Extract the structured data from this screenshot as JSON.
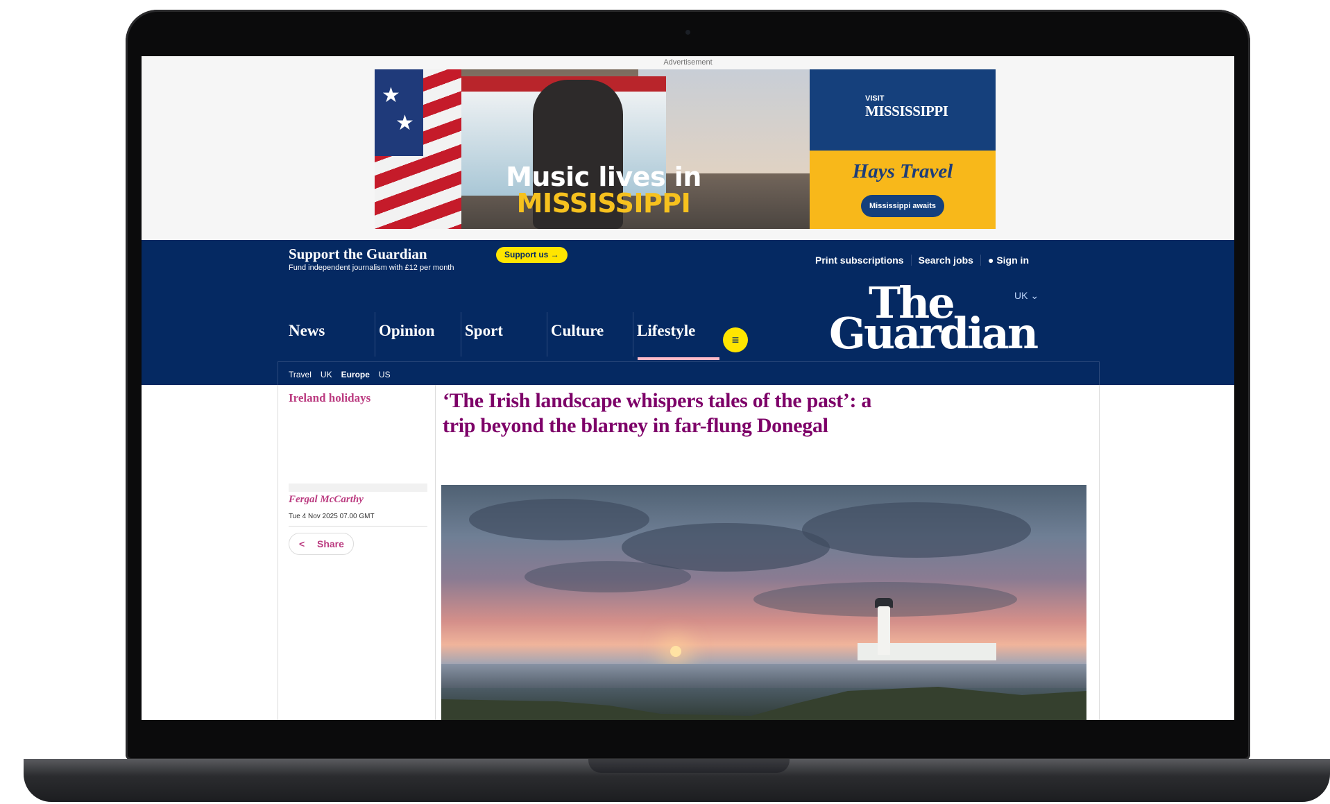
{
  "advertisement": {
    "label": "Advertisement",
    "headline_line1": "Music lives in",
    "headline_line2": "MISSISSIPPI",
    "visit_small": "VISIT",
    "visit_big": "MISSISSIPPI",
    "partner": "Hays Travel",
    "cta": "Mississippi awaits"
  },
  "support_bar": {
    "title": "Support the Guardian",
    "subtitle": "Fund independent journalism with £12 per month",
    "button": "Support us →",
    "links": [
      "Print subscriptions",
      "Search jobs",
      "Sign in"
    ]
  },
  "nav": {
    "edition": "UK ⌄",
    "logo_line1": "The",
    "logo_line2": "Guardian",
    "pillars": [
      "News",
      "Opinion",
      "Sport",
      "Culture",
      "Lifestyle"
    ],
    "active_pillar": "Lifestyle",
    "menu_icon": "≡",
    "sub_nav": [
      "Travel",
      "UK",
      "Europe",
      "US"
    ],
    "sub_nav_active": "Europe"
  },
  "article": {
    "section": "Ireland holidays",
    "headline": "‘The Irish landscape whispers tales of the past’: a trip beyond the blarney in far-flung Donegal",
    "byline": "Fergal McCarthy",
    "dateline": "Tue 4 Nov 2025 07.00 GMT",
    "share_label": "Share",
    "share_icon": "share-icon"
  },
  "colors": {
    "brand_blue": "#052962",
    "support_yellow": "#ffe500",
    "lifestyle_accent": "#7d0068",
    "lifestyle_label": "#bb3b80"
  }
}
